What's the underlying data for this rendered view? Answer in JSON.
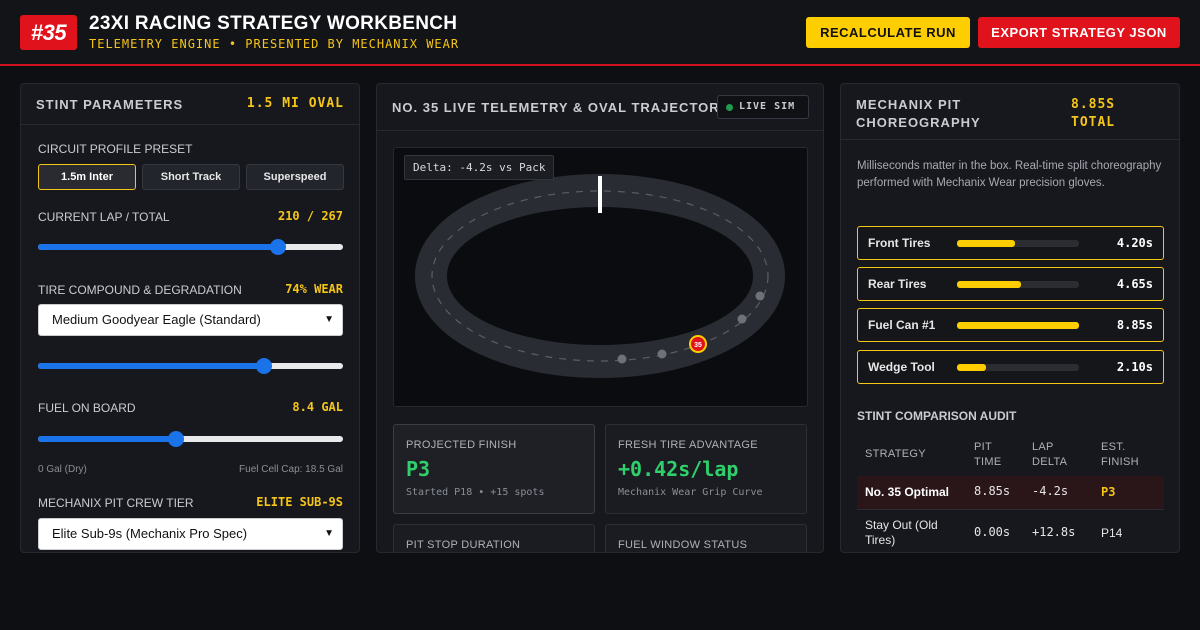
{
  "header": {
    "badge": "#35",
    "title": "23XI RACING STRATEGY WORKBENCH",
    "subtitle": "TELEMETRY ENGINE • PRESENTED BY MECHANIX WEAR",
    "recalc_label": "RECALCULATE RUN",
    "export_label": "EXPORT STRATEGY JSON"
  },
  "stint": {
    "title": "STINT PARAMETERS",
    "track": "1.5 MI OVAL",
    "preset_label": "CIRCUIT PROFILE PRESET",
    "presets": [
      "1.5m Inter",
      "Short Track",
      "Superspeed"
    ],
    "active_preset": "1.5m Inter",
    "lap_label": "CURRENT LAP / TOTAL",
    "lap_value": "210 / 267",
    "lap_current": 210,
    "lap_total": 267,
    "tire_label": "TIRE COMPOUND & DEGRADATION",
    "tire_wear": "74% WEAR",
    "tire_wear_pct": 74,
    "tire_select": "Medium Goodyear Eagle (Standard)",
    "fuel_label": "FUEL ON BOARD",
    "fuel_value": "8.4 GAL",
    "fuel_gal": 8.4,
    "fuel_capacity_gal": 18.5,
    "fuel_min_label": "0 Gal (Dry)",
    "fuel_cap_label": "Fuel Cell Cap: 18.5 Gal",
    "crew_label": "MECHANIX PIT CREW TIER",
    "crew_value": "ELITE SUB-9S",
    "crew_select": "Elite Sub-9s (Mechanix Pro Spec)"
  },
  "telemetry": {
    "title": "NO. 35 LIVE TELEMETRY & OVAL TRAJECTORY",
    "live_label": "LIVE SIM",
    "delta": "Delta: -4.2s vs Pack",
    "car_number": "35",
    "stats": [
      {
        "label": "PROJECTED FINISH",
        "value": "P3",
        "sub": "Started P18 • +15 spots"
      },
      {
        "label": "FRESH TIRE ADVANTAGE",
        "value": "+0.42s/lap",
        "sub": "Mechanix Wear Grip Curve"
      }
    ],
    "stats_partial": [
      "PIT STOP DURATION",
      "FUEL WINDOW STATUS"
    ]
  },
  "pit": {
    "title_line1": "MECHANIX PIT",
    "title_line2": "CHOREOGRAPHY",
    "total_line1": "8.85S",
    "total_line2": "TOTAL",
    "description": "Milliseconds matter in the box. Real-time split choreography performed with Mechanix Wear precision gloves.",
    "max_seconds": 8.85,
    "tasks": [
      {
        "label": "Front Tires",
        "value": "4.20s",
        "seconds": 4.2
      },
      {
        "label": "Rear Tires",
        "value": "4.65s",
        "seconds": 4.65
      },
      {
        "label": "Fuel Can #1",
        "value": "8.85s",
        "seconds": 8.85
      },
      {
        "label": "Wedge Tool",
        "value": "2.10s",
        "seconds": 2.1
      }
    ],
    "audit_title": "STINT COMPARISON AUDIT",
    "audit_headers": [
      "STRATEGY",
      "PIT TIME",
      "LAP DELTA",
      "EST. FINISH"
    ],
    "audit_rows": [
      {
        "strategy": "No. 35 Optimal",
        "pit_time": "8.85s",
        "lap_delta": "-4.2s",
        "finish": "P3"
      },
      {
        "strategy": "Stay Out (Old Tires)",
        "pit_time": "0.00s",
        "lap_delta": "+12.8s",
        "finish": "P14"
      }
    ]
  },
  "colors": {
    "accent_red": "#e0121c",
    "accent_yellow": "#ffce00",
    "positive_green": "#2fd06b",
    "slider_blue": "#1a73e8"
  },
  "icons": {
    "live_indicator": "live-dot-icon",
    "select_caret": "chevron-down-icon",
    "car_marker": "car-marker-icon"
  }
}
